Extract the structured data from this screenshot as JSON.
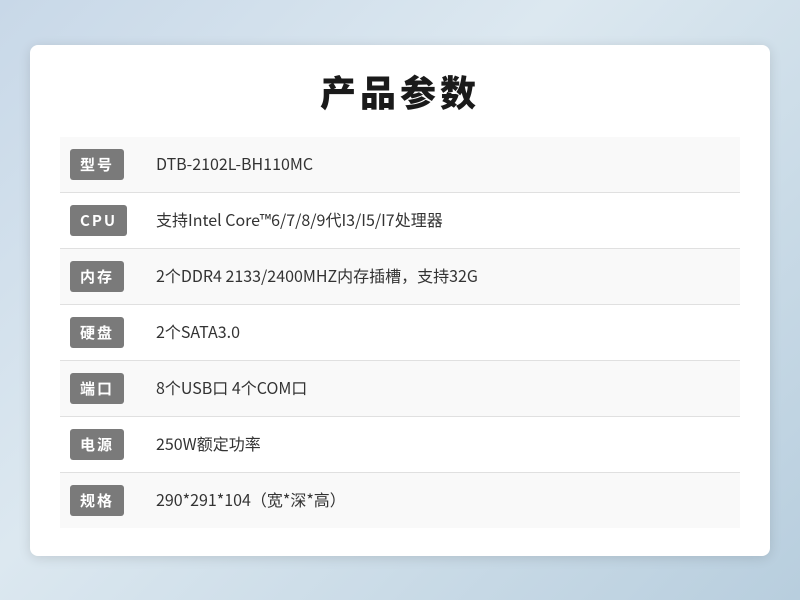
{
  "title": "产品参数",
  "rows": [
    {
      "label": "型号",
      "value": "DTB-2102L-BH110MC"
    },
    {
      "label": "CPU",
      "value": "支持Intel Core™6/7/8/9代I3/I5/I7处理器"
    },
    {
      "label": "内存",
      "value": "2个DDR4 2133/2400MHZ内存插槽，支持32G"
    },
    {
      "label": "硬盘",
      "value": "2个SATA3.0"
    },
    {
      "label": "端口",
      "value": "8个USB口 4个COM口"
    },
    {
      "label": "电源",
      "value": "250W额定功率"
    },
    {
      "label": "规格",
      "value": "290*291*104（宽*深*高）"
    }
  ]
}
